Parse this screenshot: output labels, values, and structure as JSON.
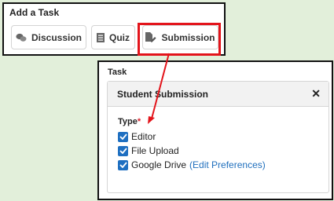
{
  "add_task": {
    "title": "Add a Task",
    "tabs": [
      {
        "label": "Discussion",
        "icon": "chat-bubbles-icon"
      },
      {
        "label": "Quiz",
        "icon": "list-icon"
      },
      {
        "label": "Submission",
        "icon": "edit-document-icon"
      }
    ]
  },
  "task": {
    "title": "Task",
    "card_title": "Student Submission",
    "close_glyph": "✕",
    "type_label": "Type",
    "required_mark": "*",
    "options": [
      {
        "label": "Editor",
        "checked": true
      },
      {
        "label": "File Upload",
        "checked": true
      },
      {
        "label": "Google Drive",
        "checked": true,
        "link": "(Edit Preferences)"
      }
    ]
  },
  "colors": {
    "background": "#e2efda",
    "highlight": "#e3141b",
    "checkbox": "#1e6fc1",
    "link": "#1f6fbd"
  }
}
